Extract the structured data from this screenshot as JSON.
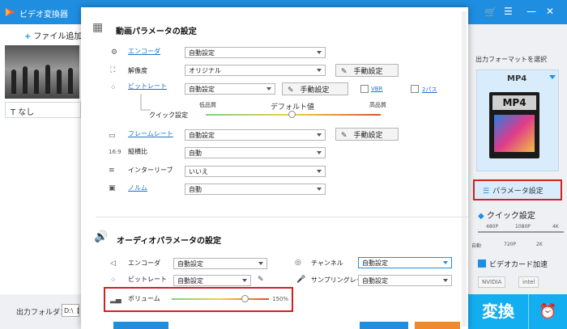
{
  "app": {
    "title": "ビデオ変換器"
  },
  "toolbar": {
    "add_file": "ファイル追加"
  },
  "subtitle": {
    "value": "なし"
  },
  "output": {
    "folder_label": "出力フォルダ：",
    "folder_path": "D:\\【Te"
  },
  "right_panel": {
    "select_format_label": "出力フォーマットを選択",
    "format_name": "MP4",
    "format_icon_tag": "MP4",
    "param_button": "パラメータ設定",
    "quick_setting": "クイック設定",
    "quality_ticks_top": [
      "480P",
      "1080P",
      "4K"
    ],
    "quality_ticks_bottom": [
      "自動",
      "720P",
      "2K"
    ],
    "gpu_label": "ビデオカード加速",
    "vendors": [
      "NVIDIA",
      "intel"
    ],
    "convert_button": "変換"
  },
  "video": {
    "title": "動画パラメータの設定",
    "encoder": {
      "label": "エンコーダ",
      "value": "自動設定"
    },
    "resolution": {
      "label": "解像度",
      "value": "オリジナル",
      "manual": "手動設定"
    },
    "bitrate": {
      "label": "ビットレート",
      "value": "自動設定",
      "manual": "手動設定",
      "vbr": "VBR",
      "twopass": "2パス"
    },
    "quick": {
      "label": "クイック設定",
      "low": "低品質",
      "default": "デフォルト値",
      "high": "高品質"
    },
    "framerate": {
      "label": "フレームレート",
      "value": "自動設定",
      "manual": "手動設定"
    },
    "aspect": {
      "label": "縦横比",
      "value": "自動"
    },
    "interlace": {
      "label": "インターリーブ",
      "value": "いいえ"
    },
    "noise": {
      "label": "ノルム",
      "value": "自動"
    }
  },
  "audio": {
    "title": "オーディオパラメータの設定",
    "encoder": {
      "label": "エンコーダ",
      "value": "自動設定"
    },
    "channel": {
      "label": "チャンネル",
      "value": "自動設定"
    },
    "bitrate": {
      "label": "ビットレート",
      "value": "自動設定"
    },
    "samplerate": {
      "label": "サンプリングレート",
      "value": "自動設定"
    },
    "volume": {
      "label": "ボリューム",
      "value": "150%",
      "level": 0.75
    }
  },
  "colors": {
    "accent": "#1f8ee0",
    "highlight": "#d42020"
  }
}
